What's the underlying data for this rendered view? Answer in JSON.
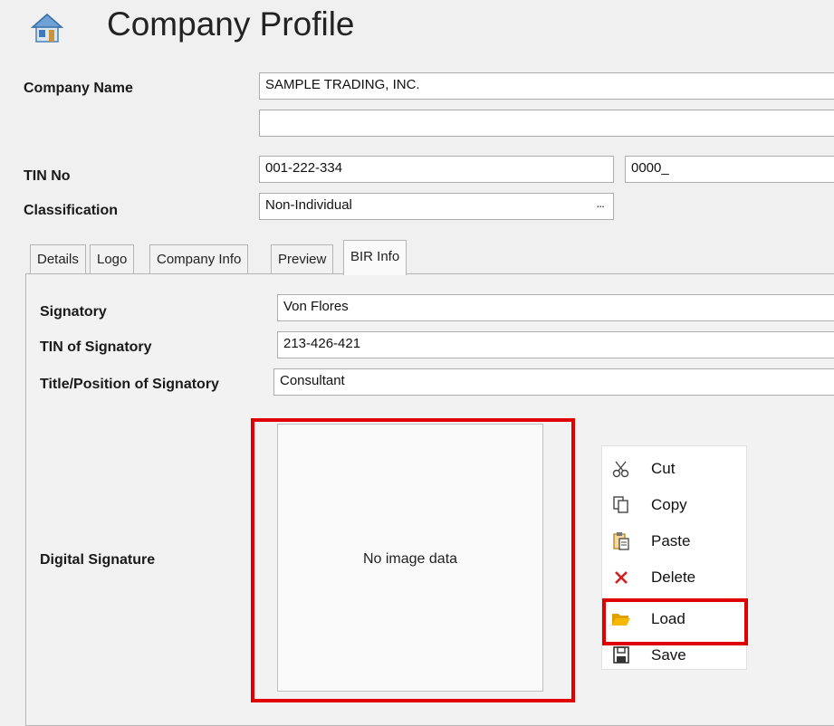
{
  "header": {
    "title": "Company Profile",
    "icon": "house-icon"
  },
  "company": {
    "name_label": "Company Name",
    "name_value": "SAMPLE TRADING, INC.",
    "name_value_2": "",
    "tin_label": "TIN No",
    "tin_value": "001-222-334",
    "tin_branch_value": "0000_",
    "classification_label": "Classification",
    "classification_value": "Non-Individual",
    "classification_button": "..."
  },
  "tabs": [
    {
      "label": "Details"
    },
    {
      "label": "Logo"
    },
    {
      "label": "Company Info"
    },
    {
      "label": "Preview"
    },
    {
      "label": "BIR Info",
      "active": true
    }
  ],
  "bir": {
    "signatory_label": "Signatory",
    "signatory_value": "Von Flores",
    "tin_signatory_label": "TIN of Signatory",
    "tin_signatory_value": "213-426-421",
    "title_label": "Title/Position of Signatory",
    "title_value": "Consultant",
    "digital_signature_label": "Digital Signature",
    "no_image_text": "No image data"
  },
  "context_menu": {
    "items": [
      {
        "label": "Cut",
        "icon": "scissors-icon"
      },
      {
        "label": "Copy",
        "icon": "copy-icon"
      },
      {
        "label": "Paste",
        "icon": "paste-icon"
      },
      {
        "label": "Delete",
        "icon": "delete-x-icon"
      },
      {
        "label": "Load",
        "icon": "folder-open-icon"
      },
      {
        "label": "Save",
        "icon": "save-disk-icon"
      }
    ]
  },
  "colors": {
    "highlight": "#e10000",
    "folder": "#f5b800",
    "delete": "#d21f1f"
  }
}
